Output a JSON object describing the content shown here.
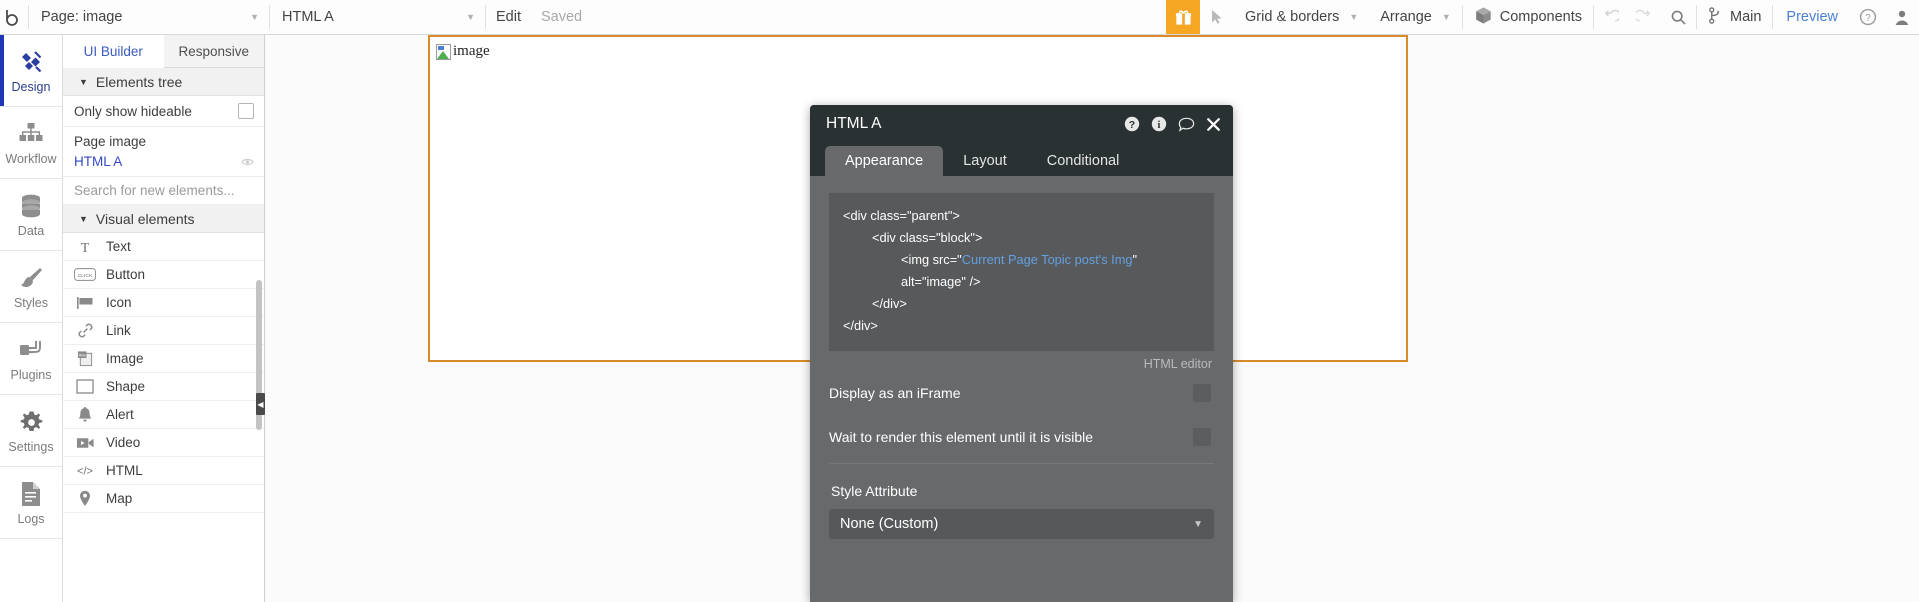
{
  "topbar": {
    "logo": "bubble-logo",
    "page_selector": {
      "label": "Page: image",
      "caret": "caret-down"
    },
    "element_selector": {
      "label": "HTML A",
      "caret": "caret-down"
    },
    "edit_label": "Edit",
    "save_status": "Saved",
    "gift_icon": "gift-icon",
    "cursor_icon": "cursor-arrow-icon",
    "grid_borders": "Grid & borders",
    "arrange": "Arrange",
    "components": "Components",
    "undo_icon": "undo-icon",
    "redo_icon": "redo-icon",
    "search_icon": "search-icon",
    "branch": "Main",
    "branch_icon": "branch-icon",
    "preview": "Preview",
    "help_icon": "help-circle-icon",
    "account_icon": "account-avatar-icon"
  },
  "rail": {
    "items": [
      {
        "label": "Design",
        "icon": "design-icon",
        "active": true
      },
      {
        "label": "Workflow",
        "icon": "workflow-icon",
        "active": false
      },
      {
        "label": "Data",
        "icon": "database-icon",
        "active": false
      },
      {
        "label": "Styles",
        "icon": "paintbrush-icon",
        "active": false
      },
      {
        "label": "Plugins",
        "icon": "plug-icon",
        "active": false
      },
      {
        "label": "Settings",
        "icon": "gear-icon",
        "active": false
      },
      {
        "label": "Logs",
        "icon": "document-icon",
        "active": false
      }
    ]
  },
  "panel": {
    "tabs": [
      {
        "label": "UI Builder",
        "active": true
      },
      {
        "label": "Responsive",
        "active": false
      }
    ],
    "elements_tree_header": "Elements tree",
    "only_show_hideable": "Only show hideable",
    "tree": [
      {
        "label": "Page image",
        "selected": false
      },
      {
        "label": "HTML A",
        "selected": true
      }
    ],
    "search_placeholder": "Search for new elements...",
    "visual_elements_header": "Visual elements",
    "elements": [
      {
        "label": "Text",
        "icon": "text-t-icon"
      },
      {
        "label": "Button",
        "icon": "button-click-icon"
      },
      {
        "label": "Icon",
        "icon": "flag-icon"
      },
      {
        "label": "Link",
        "icon": "link-chain-icon"
      },
      {
        "label": "Image",
        "icon": "image-icon"
      },
      {
        "label": "Shape",
        "icon": "shape-rectangle-icon"
      },
      {
        "label": "Alert",
        "icon": "bell-icon"
      },
      {
        "label": "Video",
        "icon": "video-camera-icon"
      },
      {
        "label": "HTML",
        "icon": "code-brackets-icon"
      },
      {
        "label": "Map",
        "icon": "map-pin-icon"
      }
    ],
    "collapse_handle": "◀"
  },
  "canvas": {
    "broken_image_alt": "image",
    "broken_image_icon": "broken-image-icon"
  },
  "dialog": {
    "title": "HTML A",
    "header_icons": [
      {
        "name": "help-circle-icon",
        "glyph": "?"
      },
      {
        "name": "info-circle-icon",
        "glyph": "i"
      },
      {
        "name": "comment-bubble-icon",
        "glyph": ""
      },
      {
        "name": "close-x-icon",
        "glyph": "✖"
      }
    ],
    "tabs": [
      {
        "label": "Appearance",
        "active": true
      },
      {
        "label": "Layout",
        "active": false
      },
      {
        "label": "Conditional",
        "active": false
      }
    ],
    "code": {
      "line1": "<div class=\"parent\">",
      "line2": "<div class=\"block\">",
      "line3_pre": "<img src=\"",
      "line3_str": "Current Page Topic post's Img",
      "line3_post": "\" alt=\"image\" />",
      "line4": "</div>",
      "line5": "</div>",
      "caption": "HTML editor"
    },
    "options": [
      {
        "label": "Display as an iFrame",
        "checked": false
      },
      {
        "label": "Wait to render this element until it is visible",
        "checked": false
      }
    ],
    "style_attribute_label": "Style Attribute",
    "style_attribute_value": "None (Custom)",
    "style_attribute_caret": "caret-down"
  },
  "colors": {
    "accent_orange": "#f5a623",
    "link_blue": "#4a7fd4",
    "dialog_bg": "#67696b",
    "dialog_header": "#2a3133",
    "canvas_frame": "#d88b2a",
    "active_rail": "#1e35b5"
  }
}
